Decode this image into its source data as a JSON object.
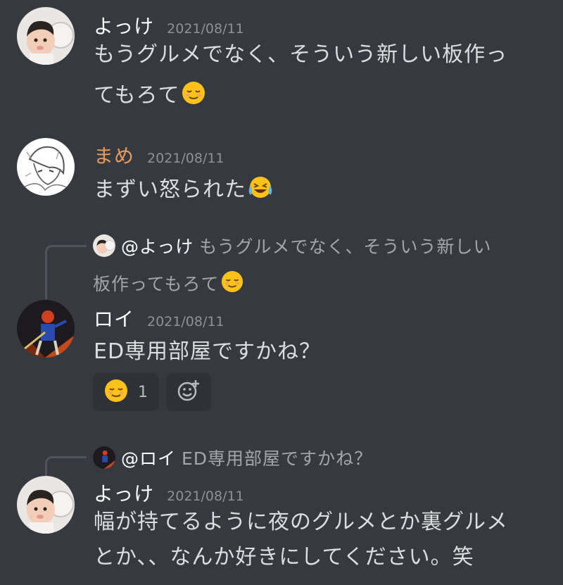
{
  "messages": [
    {
      "username": "よっけ",
      "timestamp": "2021/08/11",
      "lines": [
        "もうグルメでなく、そういう新しい板作っ",
        "てもろて"
      ],
      "emoji": "relieved-face-emoji"
    },
    {
      "username": "まめ",
      "username_color": "#e69a5c",
      "timestamp": "2021/08/11",
      "lines": [
        "まずい怒られた"
      ],
      "emoji": "joy-face-emoji"
    },
    {
      "reply_to": {
        "mention": "@よっけ",
        "text_line1": "もうグルメでなく、そういう新しい",
        "text_line2": "板作ってもろて"
      },
      "username": "ロイ",
      "timestamp": "2021/08/11",
      "lines": [
        "ED専用部屋ですかね？"
      ],
      "reactions": [
        {
          "emoji": "relieved-face-emoji",
          "count": "1"
        },
        {
          "emoji": "add-reaction-icon"
        }
      ]
    },
    {
      "reply_to": {
        "mention": "@ロイ",
        "text_line1": "ED専用部屋ですかね？"
      },
      "username": "よっけ",
      "timestamp": "2021/08/11",
      "lines": [
        "幅が持てるように夜のグルメとか裏グルメ",
        "とか、、なんか好きにしてください。笑"
      ]
    }
  ],
  "colors": {
    "background": "#36393f",
    "username_default": "#ffffff",
    "timestamp": "#8e9297",
    "reaction_bg": "#2f3136"
  }
}
